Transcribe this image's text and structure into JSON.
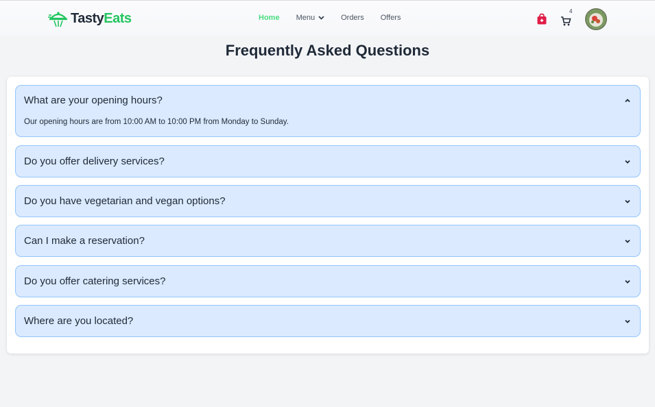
{
  "brand": {
    "name_part1": "Tasty",
    "name_part2": "Eats",
    "accent_color": "#22c55e"
  },
  "nav": {
    "links": [
      {
        "label": "Home",
        "active": true
      },
      {
        "label": "Menu",
        "has_dropdown": true
      },
      {
        "label": "Orders"
      },
      {
        "label": "Offers"
      }
    ],
    "cart_count": "4",
    "icons": [
      "shopping-bag-icon",
      "cart-icon",
      "user-avatar"
    ]
  },
  "page": {
    "title": "Frequently Asked Questions"
  },
  "faq": [
    {
      "question": "What are your opening hours?",
      "answer": "Our opening hours are from 10:00 AM to 10:00 PM from Monday to Sunday.",
      "expanded": true
    },
    {
      "question": "Do you offer delivery services?",
      "expanded": false
    },
    {
      "question": "Do you have vegetarian and vegan options?",
      "expanded": false
    },
    {
      "question": "Can I make a reservation?",
      "expanded": false
    },
    {
      "question": "Do you offer catering services?",
      "expanded": false
    },
    {
      "question": "Where are you located?",
      "expanded": false
    }
  ],
  "colors": {
    "faq_bg": "#dbeafe",
    "faq_border": "#93c5fd",
    "active_nav": "#4ade80",
    "bag_icon": "#e11d48"
  }
}
